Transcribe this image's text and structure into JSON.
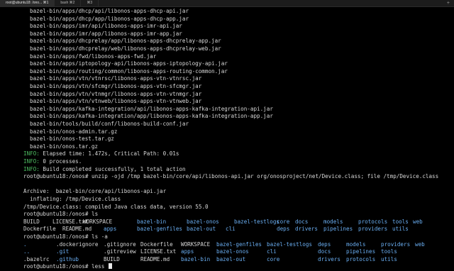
{
  "tabs": [
    {
      "label": "root@ubuntu18: /ono...  ⌘1",
      "active": true
    },
    {
      "label": "bash  ⌘2",
      "active": false
    },
    {
      "label": "⌘3",
      "active": false
    }
  ],
  "build_lines": [
    "bazel-bin/apps/dhcp/api/libonos-apps-dhcp-api.jar",
    "bazel-bin/apps/dhcp/app/libonos-apps-dhcp-app.jar",
    "bazel-bin/apps/imr/api/libonos-apps-imr-api.jar",
    "bazel-bin/apps/imr/app/libonos-apps-imr-app.jar",
    "bazel-bin/apps/dhcprelay/app/libonos-apps-dhcprelay-app.jar",
    "bazel-bin/apps/dhcprelay/web/libonos-apps-dhcprelay-web.jar",
    "bazel-bin/apps/fwd/libonos-apps-fwd.jar",
    "bazel-bin/apps/iptopology-api/libonos-apps-iptopology-api.jar",
    "bazel-bin/apps/routing/common/libonos-apps-routing-common.jar",
    "bazel-bin/apps/vtn/vtnrsc/libonos-apps-vtn-vtnrsc.jar",
    "bazel-bin/apps/vtn/sfcmgr/libonos-apps-vtn-sfcmgr.jar",
    "bazel-bin/apps/vtn/vtnmgr/libonos-apps-vtn-vtnmgr.jar",
    "bazel-bin/apps/vtn/vtnweb/libonos-apps-vtn-vtnweb.jar",
    "bazel-bin/apps/kafka-integration/api/libonos-apps-kafka-integration-api.jar",
    "bazel-bin/apps/kafka-integration/app/libonos-apps-kafka-integration-app.jar",
    "bazel-bin/tools/build/conf/libonos-build-conf.jar",
    "bazel-bin/onos-admin.tar.gz",
    "bazel-bin/onos-test.tar.gz",
    "bazel-bin/onos.tar.gz"
  ],
  "info_lines": [
    {
      "tag": "INFO:",
      "text": " Elapsed time: 1.472s, Critical Path: 0.01s"
    },
    {
      "tag": "INFO:",
      "text": " 0 processes."
    },
    {
      "tag": "INFO:",
      "text": " Build completed successfully, 1 total action"
    }
  ],
  "cmd_unzip": "root@ubuntu18:/onos# unzip -ojd /tmp bazel-bin/core/api/libonos-api.jar org/onosproject/net/Device.class; file /tmp/Device.class",
  "archive_line": "Archive:  bazel-bin/core/api/libonos-api.jar",
  "inflating_line": "  inflating: /tmp/Device.class",
  "file_line": "/tmp/Device.class: compiled Java class data, version 55.0",
  "cmd_ls": "root@ubuntu18:/onos# ls",
  "ls_items": [
    {
      "name": "BUILD",
      "dir": false
    },
    {
      "name": "LICENSE.txt",
      "dir": false
    },
    {
      "name": "WORKSPACE",
      "dir": false
    },
    {
      "name": "bazel-bin",
      "dir": true
    },
    {
      "name": "bazel-onos",
      "dir": true
    },
    {
      "name": "bazel-testlogs",
      "dir": true
    },
    {
      "name": "core",
      "dir": true
    },
    {
      "name": "docs",
      "dir": true
    },
    {
      "name": "models",
      "dir": true
    },
    {
      "name": "protocols",
      "dir": true
    },
    {
      "name": "tools",
      "dir": true
    },
    {
      "name": "web",
      "dir": true
    },
    {
      "name": "Dockerfile",
      "dir": false
    },
    {
      "name": "README.md",
      "dir": false
    },
    {
      "name": "apps",
      "dir": true
    },
    {
      "name": "bazel-genfiles",
      "dir": true
    },
    {
      "name": "bazel-out",
      "dir": true
    },
    {
      "name": "cli",
      "dir": true
    },
    {
      "name": "deps",
      "dir": true
    },
    {
      "name": "drivers",
      "dir": true
    },
    {
      "name": "pipelines",
      "dir": true
    },
    {
      "name": "providers",
      "dir": true
    },
    {
      "name": "utils",
      "dir": true
    }
  ],
  "cmd_lsa": "root@ubuntu18:/onos# ls -a",
  "lsa_items": [
    {
      "name": ".",
      "dir": true
    },
    {
      "name": ".dockerignore",
      "dir": false
    },
    {
      "name": ".gitignore",
      "dir": false
    },
    {
      "name": "Dockerfile",
      "dir": false
    },
    {
      "name": "WORKSPACE",
      "dir": false
    },
    {
      "name": "bazel-genfiles",
      "dir": true
    },
    {
      "name": "bazel-testlogs",
      "dir": true
    },
    {
      "name": "deps",
      "dir": true
    },
    {
      "name": "models",
      "dir": true
    },
    {
      "name": "providers",
      "dir": true
    },
    {
      "name": "web",
      "dir": true
    },
    {
      "name": "..",
      "dir": true
    },
    {
      "name": ".git",
      "dir": true
    },
    {
      "name": ".gitreview",
      "dir": false
    },
    {
      "name": "LICENSE.txt",
      "dir": false
    },
    {
      "name": "apps",
      "dir": true
    },
    {
      "name": "bazel-onos",
      "dir": true
    },
    {
      "name": "cli",
      "dir": true
    },
    {
      "name": "docs",
      "dir": true
    },
    {
      "name": "pipelines",
      "dir": true
    },
    {
      "name": "tools",
      "dir": true
    },
    {
      "name": ".bazelrc",
      "dir": false
    },
    {
      "name": ".github",
      "dir": true
    },
    {
      "name": "BUILD",
      "dir": false
    },
    {
      "name": "README.md",
      "dir": false
    },
    {
      "name": "bazel-bin",
      "dir": true
    },
    {
      "name": "bazel-out",
      "dir": true
    },
    {
      "name": "core",
      "dir": true
    },
    {
      "name": "drivers",
      "dir": true
    },
    {
      "name": "protocols",
      "dir": true
    },
    {
      "name": "utils",
      "dir": true
    }
  ],
  "prompt_current": "root@ubuntu18:/onos# less "
}
